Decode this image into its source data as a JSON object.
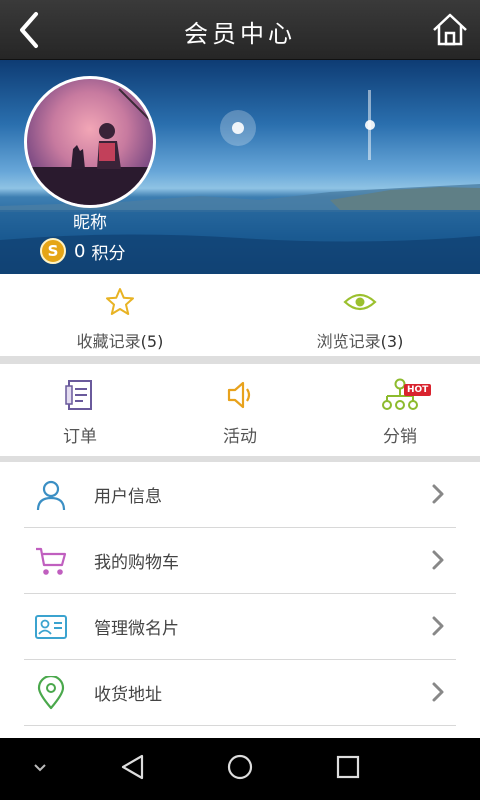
{
  "header": {
    "title": "会员中心",
    "back_icon": "back-arrow-icon",
    "home_icon": "home-icon"
  },
  "profile": {
    "nickname": "昵称",
    "points_value": "0",
    "points_label": "积分",
    "coin_symbol": "S"
  },
  "records": [
    {
      "label": "收藏记录",
      "count": "(5)",
      "icon": "star-icon"
    },
    {
      "label": "浏览记录",
      "count": "(3)",
      "icon": "eye-icon"
    }
  ],
  "actions": [
    {
      "label": "订单",
      "icon": "order-icon"
    },
    {
      "label": "活动",
      "icon": "speaker-icon"
    },
    {
      "label": "分销",
      "icon": "distribution-icon",
      "badge": "HOT"
    }
  ],
  "menu": [
    {
      "label": "用户信息",
      "icon": "user-icon"
    },
    {
      "label": "我的购物车",
      "icon": "cart-icon"
    },
    {
      "label": "管理微名片",
      "icon": "card-icon"
    },
    {
      "label": "收货地址",
      "icon": "location-icon"
    }
  ],
  "colors": {
    "topbar": "#2e2e2e",
    "star": "#e8b324",
    "eye": "#9bc02e",
    "order": "#6a5a9c",
    "speaker": "#e8a21c",
    "distribution": "#8dbb2e",
    "hot_badge": "#d9232e",
    "user": "#3b8fc4",
    "cart": "#c05fbf",
    "card": "#3ba3cf",
    "location": "#4aa84c"
  }
}
